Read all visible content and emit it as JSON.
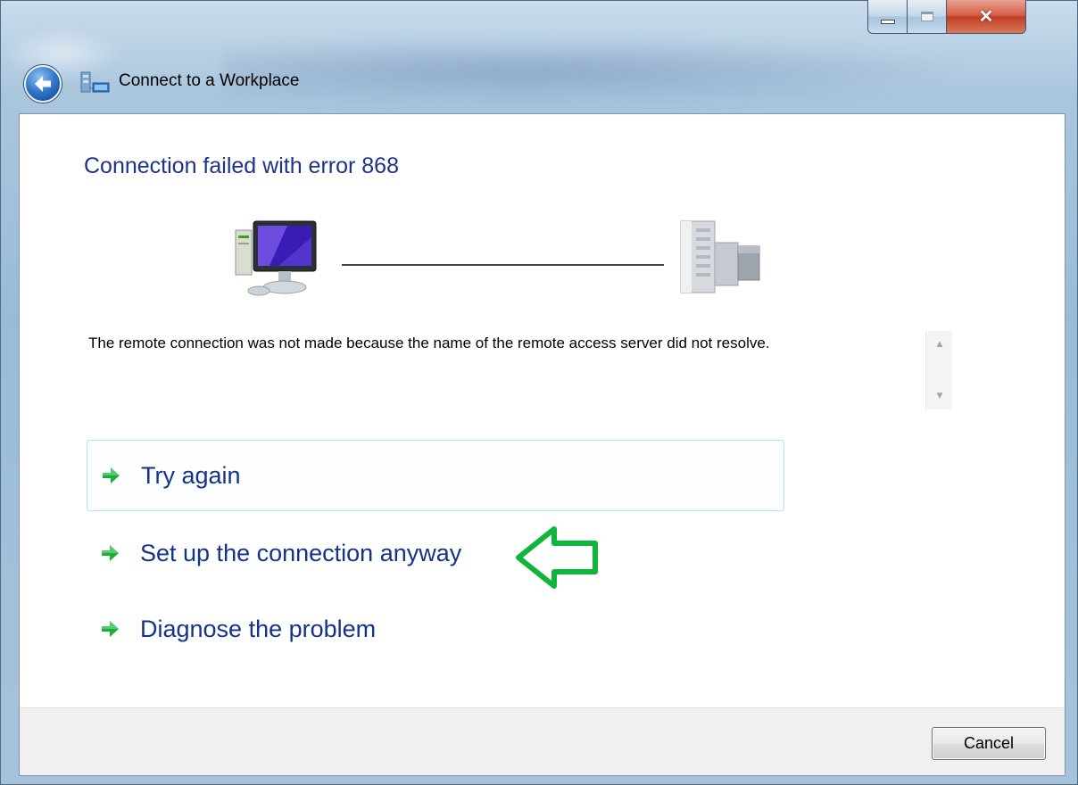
{
  "window": {
    "title": "Connect to a Workplace",
    "caption_buttons": [
      "minimize-icon",
      "maximize-icon",
      "close-icon"
    ]
  },
  "main": {
    "heading": "Connection failed with error 868",
    "message": "The remote connection was not made because the name of the remote access server did not resolve.",
    "illustration": [
      "computer-icon",
      "server-icon"
    ],
    "options": [
      {
        "label": "Try again",
        "icon": "green-arrow-icon"
      },
      {
        "label": "Set up the connection anyway",
        "icon": "green-arrow-icon"
      },
      {
        "label": "Diagnose the problem",
        "icon": "green-arrow-icon"
      }
    ],
    "annotation": "green-outline-arrow-icon"
  },
  "footer": {
    "cancel_label": "Cancel"
  },
  "colors": {
    "heading": "#1e3287",
    "link": "#14338a",
    "accent_arrow": "#1aad3a",
    "close_button": "#c8452b"
  }
}
